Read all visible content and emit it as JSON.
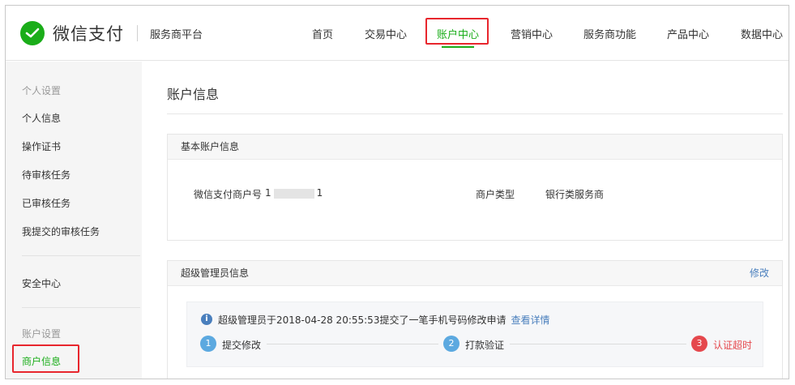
{
  "header": {
    "brand": "微信支付",
    "platform": "服务商平台",
    "nav": [
      {
        "label": "首页"
      },
      {
        "label": "交易中心"
      },
      {
        "label": "账户中心"
      },
      {
        "label": "营销中心"
      },
      {
        "label": "服务商功能"
      },
      {
        "label": "产品中心"
      },
      {
        "label": "数据中心"
      }
    ],
    "active_nav": "账户中心"
  },
  "sidebar": {
    "group1": "个人设置",
    "items1": [
      "个人信息",
      "操作证书",
      "待审核任务",
      "已审核任务",
      "我提交的审核任务"
    ],
    "security": "安全中心",
    "group2": "账户设置",
    "items2": [
      "商户信息"
    ],
    "active_item": "商户信息"
  },
  "main": {
    "title": "账户信息",
    "basic": {
      "heading": "基本账户信息",
      "merchant_id_label": "微信支付商户号",
      "merchant_id_prefix": "1",
      "merchant_id_suffix": "1",
      "merchant_type_label": "商户类型",
      "merchant_type_value": "银行类服务商"
    },
    "admin": {
      "heading": "超级管理员信息",
      "action": "修改",
      "notice": "超级管理员于2018-04-28 20:55:53提交了一笔手机号码修改申请",
      "notice_link": "查看详情",
      "steps": [
        {
          "num": "1",
          "label": "提交修改",
          "color": "#5ca9e0"
        },
        {
          "num": "2",
          "label": "打款验证",
          "color": "#5ca9e0"
        },
        {
          "num": "3",
          "label": "认证超时",
          "color": "#e5484d"
        }
      ]
    }
  },
  "colors": {
    "brand_green": "#1aad19",
    "link_blue": "#4a7fbd",
    "highlight_red": "#e8262d"
  }
}
